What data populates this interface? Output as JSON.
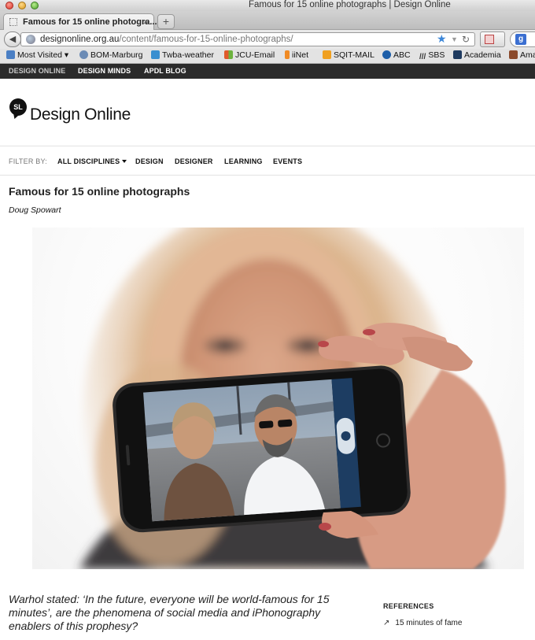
{
  "browser": {
    "window_title": "Famous for 15 online photographs | Design Online",
    "tab_label": "Famous for 15 online photogra...",
    "new_tab_label": "+",
    "url_domain": "designonline.org.au",
    "url_path": "/content/famous-for-15-online-photographs/",
    "bookmarks": [
      {
        "label": "Most Visited",
        "icon": "folder-icon",
        "color": "#4a7fc4"
      },
      {
        "label": "BOM-Marburg",
        "icon": "globe-icon",
        "color": "#6b8bb5"
      },
      {
        "label": "Twba-weather",
        "icon": "wz-icon",
        "color": "#3a8fd0"
      },
      {
        "label": "JCU-Email",
        "icon": "windows-icon",
        "color": "#e05a2b"
      },
      {
        "label": "iiNet",
        "icon": "iinet-icon",
        "color": "#f08a24"
      },
      {
        "label": "SQIT-MAIL",
        "icon": "outlook-icon",
        "color": "#f0a020"
      },
      {
        "label": "ABC",
        "icon": "abc-icon",
        "color": "#1d5ea8"
      },
      {
        "label": "SBS",
        "icon": "sbs-icon",
        "color": "#333333"
      },
      {
        "label": "Academia",
        "icon": "academia-icon",
        "color": "#1e3a5f"
      },
      {
        "label": "Ama",
        "icon": "amazon-icon",
        "color": "#8b4a2b"
      }
    ]
  },
  "site": {
    "top_nav": [
      "DESIGN ONLINE",
      "DESIGN MINDS",
      "APDL BLOG"
    ],
    "logo_badge": "SL",
    "logo_text": "Design Online",
    "filter_label": "FILTER BY:",
    "filters": [
      "ALL DISCIPLINES",
      "DESIGN",
      "DESIGNER",
      "LEARNING",
      "EVENTS"
    ]
  },
  "article": {
    "title": "Famous for 15 online photographs",
    "author": "Doug Spowart",
    "lede": "Warhol stated: ‘In the future, everyone will be world-famous for 15 minutes’, are the phenomena of social media and iPhonography enablers of this prophesy?"
  },
  "references": {
    "title": "REFERENCES",
    "items": [
      "15 minutes of fame"
    ]
  },
  "colors": {
    "site_bar": "#2b2b2b",
    "accent_star": "#3b86d8"
  }
}
